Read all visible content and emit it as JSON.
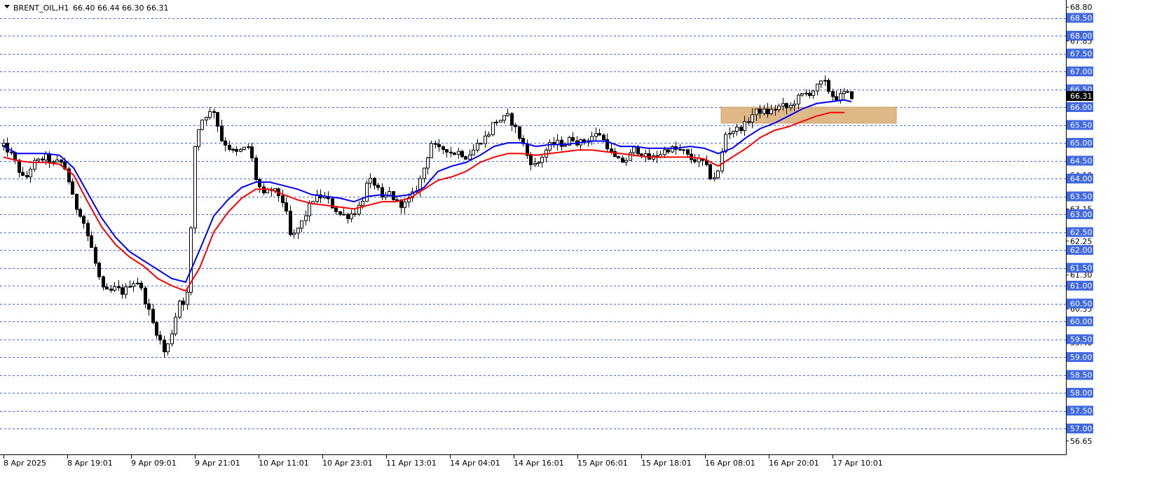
{
  "chart_data": {
    "type": "candlestick",
    "symbol": "BRENT_OIL,H1",
    "ohlc_header": "66.40 66.44 66.30 66.31",
    "last_price": "66.31",
    "ylim": [
      56.5,
      68.9
    ],
    "grid": "horizontal dashed at price levels",
    "grid_levels": [
      68.5,
      68.0,
      67.5,
      67.0,
      66.5,
      66.0,
      65.5,
      65.0,
      64.5,
      64.0,
      63.5,
      63.0,
      62.5,
      62.0,
      61.5,
      61.0,
      60.5,
      60.0,
      59.5,
      59.0,
      58.5,
      58.0,
      57.5,
      57.0
    ],
    "y_ticks": [
      "68.80",
      "67.85",
      "64.10",
      "63.15",
      "62.25",
      "61.30",
      "60.35",
      "59.40",
      "57.50",
      "56.65"
    ],
    "highlight_labels": [
      "68.50",
      "68.00",
      "67.50",
      "67.00",
      "66.50",
      "66.00",
      "65.50",
      "65.00",
      "64.50",
      "64.00",
      "63.50",
      "63.00",
      "62.50",
      "62.00",
      "61.50",
      "61.00",
      "60.50",
      "60.00",
      "59.50",
      "59.00",
      "58.50",
      "58.00",
      "57.50",
      "57.00"
    ],
    "x_labels": [
      "8 Apr 2025",
      "8 Apr 19:01",
      "9 Apr 09:01",
      "9 Apr 21:01",
      "10 Apr 11:01",
      "10 Apr 23:01",
      "11 Apr 13:01",
      "14 Apr 04:01",
      "14 Apr 16:01",
      "15 Apr 06:01",
      "15 Apr 18:01",
      "16 Apr 08:01",
      "16 Apr 20:01",
      "17 Apr 10:01"
    ],
    "zone": {
      "price_low": 65.55,
      "price_high": 66.0,
      "color": "#deb887"
    },
    "series": [
      {
        "name": "",
        "color": "#0000ff",
        "values": [
          [
            0,
            64.9
          ],
          [
            20,
            64.7
          ],
          [
            40,
            64.7
          ],
          [
            60,
            64.7
          ],
          [
            80,
            64.65
          ],
          [
            100,
            64.3
          ],
          [
            120,
            63.6
          ],
          [
            140,
            62.9
          ],
          [
            160,
            62.35
          ],
          [
            180,
            61.95
          ],
          [
            200,
            61.7
          ],
          [
            220,
            61.45
          ],
          [
            240,
            61.2
          ],
          [
            260,
            61.1
          ],
          [
            280,
            62.0
          ],
          [
            300,
            62.95
          ],
          [
            320,
            63.4
          ],
          [
            340,
            63.75
          ],
          [
            360,
            63.9
          ],
          [
            380,
            63.9
          ],
          [
            400,
            63.8
          ],
          [
            420,
            63.7
          ],
          [
            440,
            63.55
          ],
          [
            460,
            63.5
          ],
          [
            480,
            63.45
          ],
          [
            500,
            63.35
          ],
          [
            520,
            63.5
          ],
          [
            540,
            63.55
          ],
          [
            560,
            63.5
          ],
          [
            580,
            63.55
          ],
          [
            600,
            63.75
          ],
          [
            620,
            64.2
          ],
          [
            640,
            64.35
          ],
          [
            660,
            64.45
          ],
          [
            680,
            64.65
          ],
          [
            700,
            64.9
          ],
          [
            720,
            65.0
          ],
          [
            740,
            65.0
          ],
          [
            760,
            64.9
          ],
          [
            780,
            64.95
          ],
          [
            800,
            64.95
          ],
          [
            820,
            65.0
          ],
          [
            840,
            65.05
          ],
          [
            860,
            65.05
          ],
          [
            880,
            64.9
          ],
          [
            900,
            64.9
          ],
          [
            920,
            64.85
          ],
          [
            940,
            64.85
          ],
          [
            960,
            64.85
          ],
          [
            980,
            64.9
          ],
          [
            1000,
            64.85
          ],
          [
            1020,
            64.7
          ],
          [
            1040,
            64.85
          ],
          [
            1060,
            65.15
          ],
          [
            1080,
            65.4
          ],
          [
            1100,
            65.55
          ],
          [
            1120,
            65.75
          ],
          [
            1140,
            65.95
          ],
          [
            1160,
            66.1
          ],
          [
            1180,
            66.15
          ],
          [
            1200,
            66.2
          ],
          [
            1210,
            66.15
          ]
        ]
      },
      {
        "name": "",
        "color": "#ff0000",
        "values": [
          [
            0,
            64.6
          ],
          [
            20,
            64.5
          ],
          [
            40,
            64.45
          ],
          [
            60,
            64.45
          ],
          [
            80,
            64.4
          ],
          [
            100,
            64.1
          ],
          [
            120,
            63.35
          ],
          [
            140,
            62.65
          ],
          [
            160,
            62.15
          ],
          [
            180,
            61.8
          ],
          [
            200,
            61.55
          ],
          [
            220,
            61.2
          ],
          [
            240,
            61.0
          ],
          [
            260,
            60.85
          ],
          [
            280,
            61.5
          ],
          [
            300,
            62.5
          ],
          [
            320,
            63.05
          ],
          [
            340,
            63.45
          ],
          [
            360,
            63.7
          ],
          [
            380,
            63.7
          ],
          [
            400,
            63.55
          ],
          [
            420,
            63.4
          ],
          [
            440,
            63.3
          ],
          [
            460,
            63.25
          ],
          [
            480,
            63.2
          ],
          [
            500,
            63.15
          ],
          [
            520,
            63.25
          ],
          [
            540,
            63.35
          ],
          [
            560,
            63.35
          ],
          [
            580,
            63.45
          ],
          [
            600,
            63.7
          ],
          [
            620,
            63.95
          ],
          [
            640,
            64.05
          ],
          [
            660,
            64.2
          ],
          [
            680,
            64.45
          ],
          [
            700,
            64.6
          ],
          [
            720,
            64.7
          ],
          [
            740,
            64.7
          ],
          [
            760,
            64.65
          ],
          [
            780,
            64.7
          ],
          [
            800,
            64.75
          ],
          [
            820,
            64.8
          ],
          [
            840,
            64.8
          ],
          [
            860,
            64.75
          ],
          [
            880,
            64.7
          ],
          [
            900,
            64.65
          ],
          [
            920,
            64.6
          ],
          [
            940,
            64.6
          ],
          [
            960,
            64.6
          ],
          [
            980,
            64.6
          ],
          [
            1000,
            64.55
          ],
          [
            1020,
            64.35
          ],
          [
            1040,
            64.6
          ],
          [
            1060,
            64.85
          ],
          [
            1080,
            65.15
          ],
          [
            1100,
            65.35
          ],
          [
            1120,
            65.45
          ],
          [
            1140,
            65.6
          ],
          [
            1160,
            65.75
          ],
          [
            1180,
            65.85
          ],
          [
            1200,
            65.85
          ]
        ]
      }
    ],
    "anchors": [
      [
        0,
        64.9
      ],
      [
        10,
        64.7
      ],
      [
        20,
        64.3
      ],
      [
        30,
        63.9
      ],
      [
        40,
        64.4
      ],
      [
        50,
        64.5
      ],
      [
        60,
        64.6
      ],
      [
        70,
        64.4
      ],
      [
        80,
        64.5
      ],
      [
        90,
        64.2
      ],
      [
        100,
        63.3
      ],
      [
        110,
        63.0
      ],
      [
        120,
        62.4
      ],
      [
        130,
        61.7
      ],
      [
        140,
        60.9
      ],
      [
        150,
        60.8
      ],
      [
        160,
        60.95
      ],
      [
        170,
        60.8
      ],
      [
        180,
        61.05
      ],
      [
        190,
        61.15
      ],
      [
        200,
        60.7
      ],
      [
        210,
        60.1
      ],
      [
        220,
        59.6
      ],
      [
        230,
        59.1
      ],
      [
        240,
        59.7
      ],
      [
        250,
        60.6
      ],
      [
        260,
        60.5
      ],
      [
        265,
        61.2
      ],
      [
        270,
        64.6
      ],
      [
        280,
        65.6
      ],
      [
        290,
        65.8
      ],
      [
        300,
        65.9
      ],
      [
        310,
        65.1
      ],
      [
        320,
        64.9
      ],
      [
        330,
        64.7
      ],
      [
        340,
        64.8
      ],
      [
        350,
        64.9
      ],
      [
        360,
        64.0
      ],
      [
        370,
        63.5
      ],
      [
        380,
        63.7
      ],
      [
        390,
        63.6
      ],
      [
        400,
        63.3
      ],
      [
        410,
        62.3
      ],
      [
        420,
        62.6
      ],
      [
        430,
        62.95
      ],
      [
        440,
        63.4
      ],
      [
        450,
        63.5
      ],
      [
        460,
        63.45
      ],
      [
        470,
        63.2
      ],
      [
        480,
        63.0
      ],
      [
        490,
        62.95
      ],
      [
        500,
        63.05
      ],
      [
        510,
        63.3
      ],
      [
        520,
        63.95
      ],
      [
        530,
        63.85
      ],
      [
        540,
        63.4
      ],
      [
        550,
        63.6
      ],
      [
        560,
        63.35
      ],
      [
        570,
        63.25
      ],
      [
        580,
        63.45
      ],
      [
        590,
        63.75
      ],
      [
        600,
        64.3
      ],
      [
        610,
        65.0
      ],
      [
        620,
        64.8
      ],
      [
        630,
        64.85
      ],
      [
        640,
        64.7
      ],
      [
        650,
        64.75
      ],
      [
        660,
        64.6
      ],
      [
        670,
        64.8
      ],
      [
        680,
        65.05
      ],
      [
        690,
        65.2
      ],
      [
        700,
        65.6
      ],
      [
        710,
        65.65
      ],
      [
        720,
        65.75
      ],
      [
        730,
        65.4
      ],
      [
        740,
        65.0
      ],
      [
        750,
        64.5
      ],
      [
        760,
        64.35
      ],
      [
        770,
        64.7
      ],
      [
        780,
        64.95
      ],
      [
        790,
        65.0
      ],
      [
        800,
        64.95
      ],
      [
        810,
        65.15
      ],
      [
        820,
        65.0
      ],
      [
        830,
        65.05
      ],
      [
        840,
        65.2
      ],
      [
        850,
        65.25
      ],
      [
        860,
        64.95
      ],
      [
        870,
        64.6
      ],
      [
        880,
        64.45
      ],
      [
        890,
        64.55
      ],
      [
        900,
        64.85
      ],
      [
        910,
        64.7
      ],
      [
        920,
        64.55
      ],
      [
        930,
        64.6
      ],
      [
        940,
        64.75
      ],
      [
        950,
        64.85
      ],
      [
        960,
        64.8
      ],
      [
        970,
        64.75
      ],
      [
        980,
        64.55
      ],
      [
        990,
        64.5
      ],
      [
        1000,
        64.45
      ],
      [
        1010,
        63.95
      ],
      [
        1020,
        64.2
      ],
      [
        1030,
        65.25
      ],
      [
        1040,
        65.35
      ],
      [
        1050,
        65.4
      ],
      [
        1060,
        65.55
      ],
      [
        1070,
        65.85
      ],
      [
        1080,
        65.9
      ],
      [
        1090,
        65.85
      ],
      [
        1100,
        65.95
      ],
      [
        1110,
        66.05
      ],
      [
        1120,
        65.95
      ],
      [
        1130,
        66.2
      ],
      [
        1140,
        66.35
      ],
      [
        1150,
        66.4
      ],
      [
        1160,
        66.55
      ],
      [
        1170,
        66.75
      ],
      [
        1180,
        66.35
      ],
      [
        1190,
        66.25
      ],
      [
        1200,
        66.4
      ],
      [
        1210,
        66.31
      ]
    ]
  }
}
